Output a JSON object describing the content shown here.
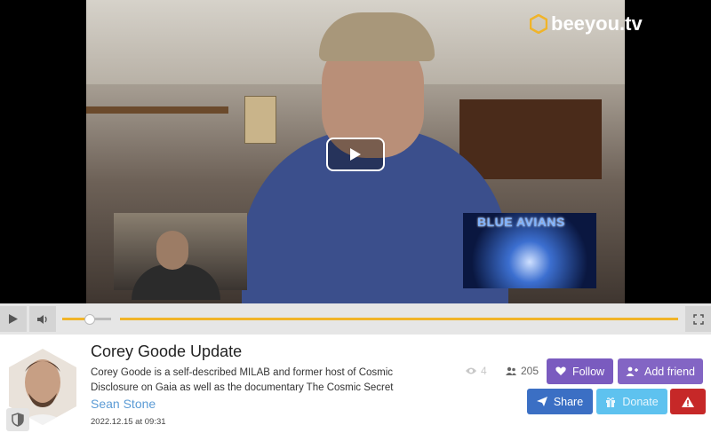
{
  "brand": {
    "logo_text": "beeyou.tv",
    "accent": "#f0b429"
  },
  "stream": {
    "overlay_text": "BLUE AVIANS"
  },
  "player": {
    "volume_level": 0.55,
    "progress": 1.0
  },
  "video": {
    "title": "Corey Goode Update",
    "description": "Corey Goode is a self-described MILAB and former host of Cosmic Disclosure on Gaia as well as the documentary The Cosmic Secret",
    "author": "Sean Stone",
    "date": "2022.12.15 at 09:31"
  },
  "stats": {
    "views": "4",
    "followers": "205"
  },
  "actions": {
    "follow": "Follow",
    "add_friend": "Add friend",
    "share": "Share",
    "donate": "Donate"
  },
  "colors": {
    "follow": "#7a5bbf",
    "add_friend": "#8365c4",
    "share": "#3b6fc4",
    "donate": "#5ec2ef",
    "report": "#c62828"
  },
  "icons": [
    "play-icon",
    "volume-icon",
    "fullscreen-icon",
    "shield-icon",
    "eye-icon",
    "users-icon",
    "heart-icon",
    "user-plus-icon",
    "share-icon",
    "gift-icon",
    "warning-icon"
  ]
}
